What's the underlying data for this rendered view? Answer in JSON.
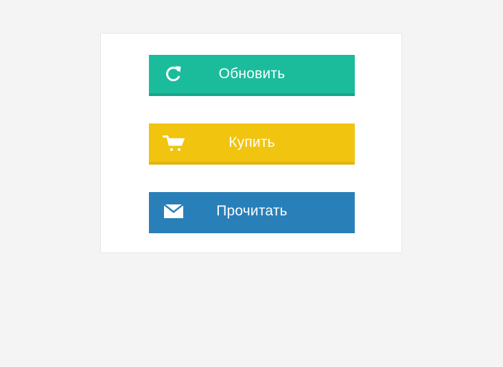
{
  "buttons": {
    "refresh": {
      "label": "Обновить",
      "icon": "refresh-icon",
      "color": "#1abc9c",
      "border_color": "#17a589"
    },
    "buy": {
      "label": "Купить",
      "icon": "cart-icon",
      "color": "#f1c40f",
      "border_color": "#e2b40a"
    },
    "read": {
      "label": "Прочитать",
      "icon": "envelope-icon",
      "color": "#2980b9",
      "border_color": "#2980b9"
    }
  }
}
